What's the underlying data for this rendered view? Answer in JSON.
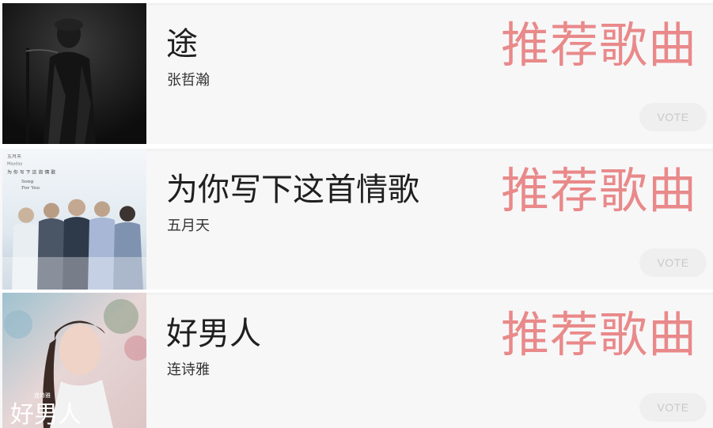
{
  "songs": [
    {
      "title": "途",
      "artist": "张哲瀚",
      "tag": "推荐歌曲",
      "vote_label": "VOTE",
      "cover_text": []
    },
    {
      "title": "为你写下这首情歌",
      "artist": "五月天",
      "tag": "推荐歌曲",
      "vote_label": "VOTE",
      "cover_text": [
        "五月天",
        "Mayday",
        "为 你 写 下 这 首 情 歌",
        "Song",
        "For You"
      ]
    },
    {
      "title": "好男人",
      "artist": "连诗雅",
      "tag": "推荐歌曲",
      "vote_label": "VOTE",
      "cover_text": [
        "好男人",
        "连诗雅"
      ]
    }
  ],
  "colors": {
    "tag": "#e9898a",
    "card_bg": "#f7f7f8",
    "vote_bg": "#efefef",
    "vote_text": "#c9c9c9"
  }
}
